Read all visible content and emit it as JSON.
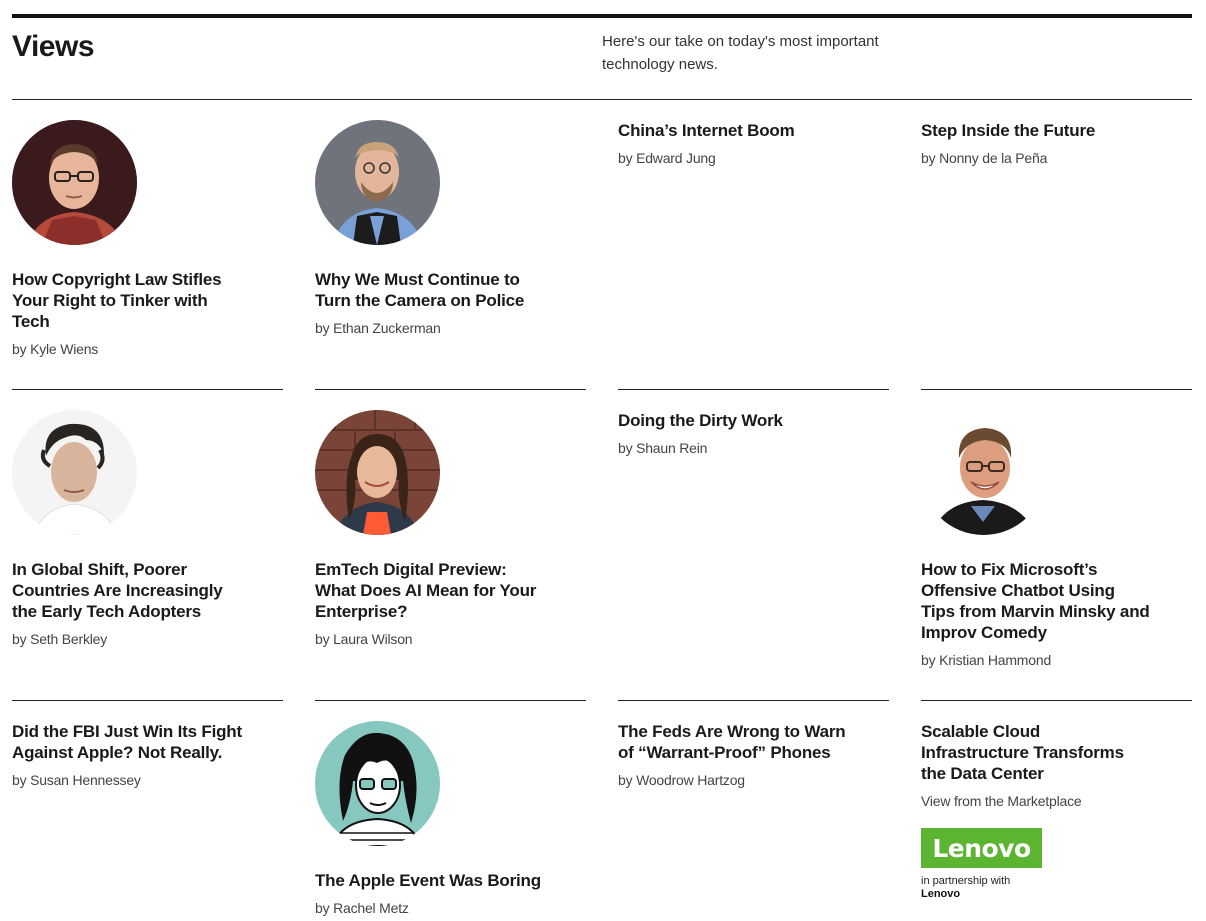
{
  "header": {
    "title": "Views",
    "intro": "Here's our take on today's most important technology news."
  },
  "articles": [
    {
      "headline": "How Copyright Law Stifles Your Right to Tinker with Tech",
      "byline": "by Kyle Wiens"
    },
    {
      "headline": "Why We Must Continue to Turn the Camera on Police",
      "byline": "by Ethan Zuckerman"
    },
    {
      "headline": "China’s Internet Boom",
      "byline": "by Edward Jung"
    },
    {
      "headline": "Step Inside the Future",
      "byline": "by Nonny de la Peña"
    },
    {
      "headline": "In Global Shift, Poorer Countries Are Increasingly the Early Tech Adopters",
      "byline": "by Seth Berkley"
    },
    {
      "headline": "EmTech Digital Preview: What Does AI Mean for Your Enterprise?",
      "byline": "by Laura Wilson"
    },
    {
      "headline": "Doing the Dirty Work",
      "byline": "by Shaun Rein"
    },
    {
      "headline": "How to Fix Microsoft’s Offensive Chatbot Using Tips from Marvin Minsky and Improv Comedy",
      "byline": "by Kristian Hammond"
    },
    {
      "headline": "Did the FBI Just Win Its Fight Against Apple? Not Really.",
      "byline": "by Susan Hennessey"
    },
    {
      "headline": "The Apple Event Was Boring",
      "byline": "by Rachel Metz"
    },
    {
      "headline": "The Feds Are Wrong to Warn of “Warrant-Proof” Phones",
      "byline": "by Woodrow Hartzog"
    },
    {
      "headline": "Scalable Cloud Infrastructure Transforms the Data Center",
      "byline": "View from the Marketplace"
    }
  ],
  "sponsor": {
    "logo_text": "Lenovo",
    "partnership_label": "in partnership with",
    "name": "Lenovo",
    "brand_color": "#5cb531"
  },
  "colors": {
    "rule": "#222222",
    "text": "#1a1a1a",
    "byline": "#444444"
  }
}
